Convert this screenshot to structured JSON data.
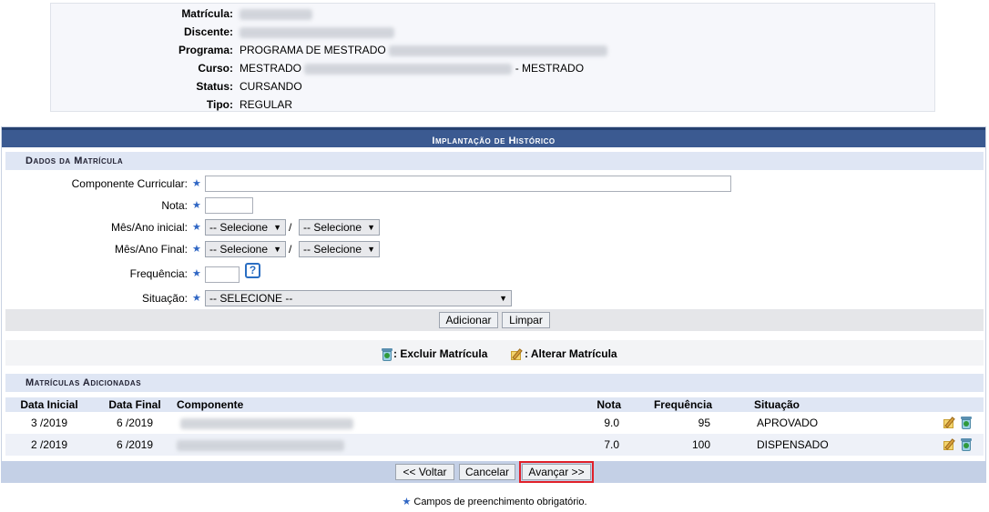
{
  "student_info": [
    {
      "label": "Matrícula:",
      "value": "",
      "blurred_width": 80
    },
    {
      "label": "Discente:",
      "value": "",
      "blurred_width": 170
    },
    {
      "label": "Programa:",
      "value": "PROGRAMA DE MESTRADO",
      "blurred_width": 240
    },
    {
      "label": "Curso:",
      "value": "MESTRADO",
      "blurred_width": 228,
      "suffix": "- MESTRADO"
    },
    {
      "label": "Status:",
      "value": "CURSANDO"
    },
    {
      "label": "Tipo:",
      "value": "REGULAR"
    }
  ],
  "panel_title": "Implantação de Histórico",
  "section_dados": "Dados da Matrícula",
  "fields": {
    "componente_label": "Componente Curricular:",
    "nota_label": "Nota:",
    "mes_inicial_label": "Mês/Ano inicial:",
    "mes_final_label": "Mês/Ano Final:",
    "frequencia_label": "Frequência:",
    "situacao_label": "Situação:",
    "select_placeholder": "-- Selecione",
    "situacao_placeholder": "-- SELECIONE --",
    "help_glyph": "?",
    "slash": "/"
  },
  "buttons": {
    "adicionar": "Adicionar",
    "limpar": "Limpar",
    "voltar": "<< Voltar",
    "cancelar": "Cancelar",
    "avancar": "Avançar >>"
  },
  "legend": {
    "excluir": ": Excluir Matrícula",
    "alterar": ": Alterar Matrícula"
  },
  "section_adicionadas": "Matrículas Adicionadas",
  "table": {
    "headers": [
      "Data Inicial",
      "Data Final",
      "Componente",
      "Nota",
      "Frequência",
      "Situação"
    ],
    "rows": [
      {
        "data_inicial": "3 /2019",
        "data_final": "6 /2019",
        "componente": "",
        "nota": "9.0",
        "frequencia": "95",
        "situacao": "APROVADO"
      },
      {
        "data_inicial": "2 /2019",
        "data_final": "6 /2019",
        "componente": "",
        "nota": "7.0",
        "frequencia": "100",
        "situacao": "DISPENSADO"
      }
    ]
  },
  "footnote": "Campos de preenchimento obrigatório.",
  "icons": {
    "required": "star-icon",
    "delete": "trash-icon",
    "edit": "edit-pencil-icon",
    "help": "help-icon"
  },
  "colors": {
    "header_blue": "#3b5a91",
    "section_bg": "#dfe6f4",
    "highlight_red": "#e0202a",
    "star_blue": "#2f66c4"
  }
}
